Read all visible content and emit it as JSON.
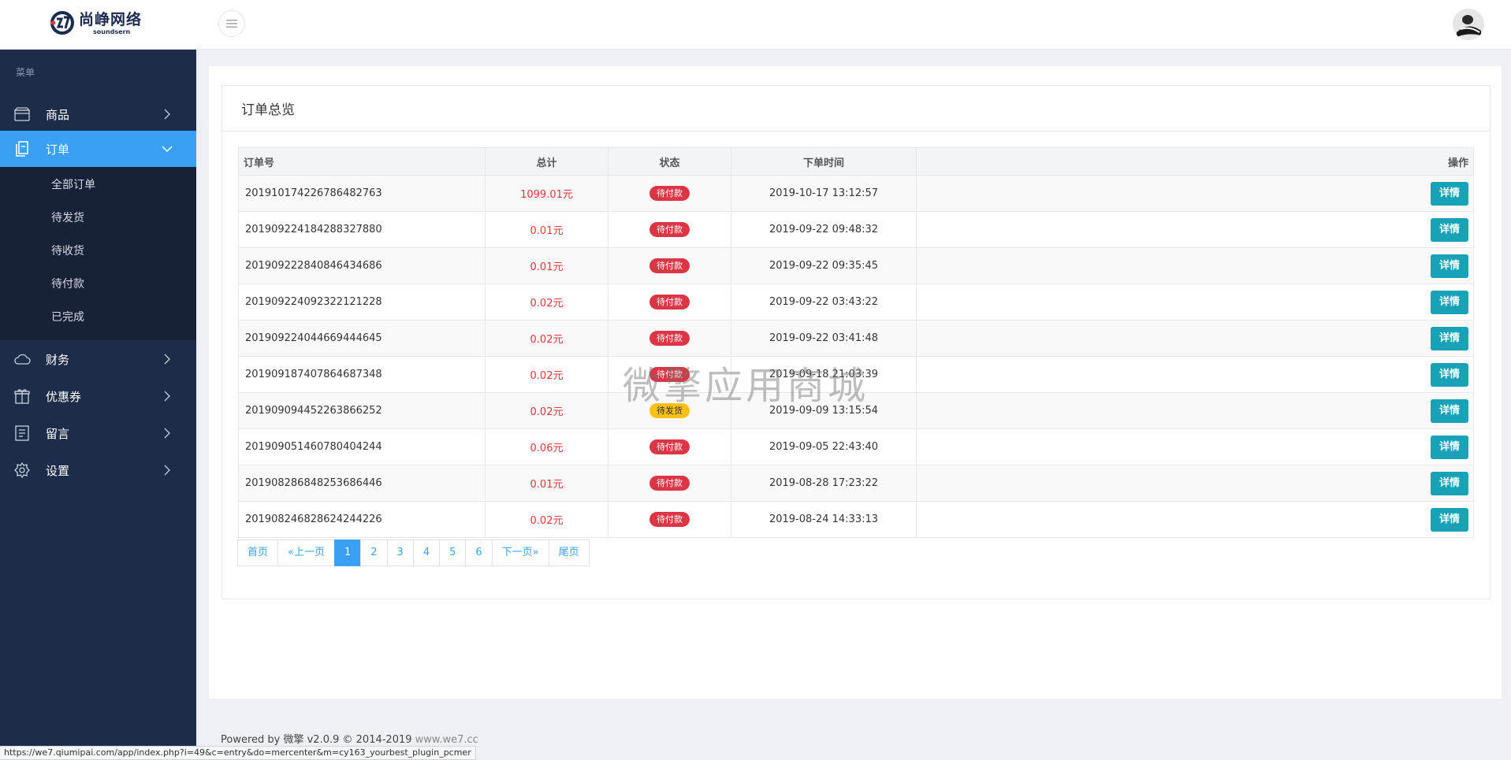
{
  "brand": {
    "name_cn": "尚峥网络",
    "name_en": "soundsern"
  },
  "sidebar": {
    "caption": "菜单",
    "items": [
      {
        "label": "商品",
        "icon": "box-icon"
      },
      {
        "label": "订单",
        "icon": "document-icon",
        "active": true
      },
      {
        "label": "财务",
        "icon": "cloud-icon"
      },
      {
        "label": "优惠券",
        "icon": "gift-icon"
      },
      {
        "label": "留言",
        "icon": "message-list-icon"
      },
      {
        "label": "设置",
        "icon": "gear-icon"
      }
    ],
    "order_submenu": [
      "全部订单",
      "待发货",
      "待收货",
      "待付款",
      "已完成"
    ]
  },
  "panel": {
    "title": "订单总览",
    "columns": [
      "订单号",
      "总计",
      "状态",
      "下单时间",
      "操作"
    ],
    "detail_label": "详情",
    "rows": [
      {
        "order_no": "201910174226786482763",
        "total": "1099.01元",
        "status": "待付款",
        "status_color": "#dc3545",
        "time": "2019-10-17 13:12:57"
      },
      {
        "order_no": "201909224184288327880",
        "total": "0.01元",
        "status": "待付款",
        "status_color": "#dc3545",
        "time": "2019-09-22 09:48:32"
      },
      {
        "order_no": "201909222840846434686",
        "total": "0.01元",
        "status": "待付款",
        "status_color": "#dc3545",
        "time": "2019-09-22 09:35:45"
      },
      {
        "order_no": "201909224092322121228",
        "total": "0.02元",
        "status": "待付款",
        "status_color": "#dc3545",
        "time": "2019-09-22 03:43:22"
      },
      {
        "order_no": "201909224044669444645",
        "total": "0.02元",
        "status": "待付款",
        "status_color": "#dc3545",
        "time": "2019-09-22 03:41:48"
      },
      {
        "order_no": "201909187407864687348",
        "total": "0.02元",
        "status": "待付款",
        "status_color": "#dc3545",
        "time": "2019-09-18 21:03:39"
      },
      {
        "order_no": "201909094452263866252",
        "total": "0.02元",
        "status": "待发货",
        "status_color": "#fcc014",
        "time": "2019-09-09 13:15:54"
      },
      {
        "order_no": "201909051460780404244",
        "total": "0.06元",
        "status": "待付款",
        "status_color": "#dc3545",
        "time": "2019-09-05 22:43:40"
      },
      {
        "order_no": "201908286848253686446",
        "total": "0.01元",
        "status": "待付款",
        "status_color": "#dc3545",
        "time": "2019-08-28 17:23:22"
      },
      {
        "order_no": "201908246828624244226",
        "total": "0.02元",
        "status": "待付款",
        "status_color": "#dc3545",
        "time": "2019-08-24 14:33:13"
      }
    ]
  },
  "pagination": {
    "first": "首页",
    "prev": "«上一页",
    "pages": [
      "1",
      "2",
      "3",
      "4",
      "5",
      "6"
    ],
    "current": "1",
    "next": "下一页»",
    "last": "尾页"
  },
  "watermark": "微擎应用商城",
  "footer": {
    "text": "Powered by 微擎 v2.0.9 © 2014-2019 ",
    "link": "www.we7.cc"
  },
  "status_url": "https://we7.qiumipai.com/app/index.php?i=49&c=entry&do=mercenter&m=cy163_yourbest_plugin_pcmer",
  "colors": {
    "sidebar_bg": "#1d2c48",
    "accent": "#3aa0f3",
    "detail_button": "#17a2b8",
    "price_red": "#e8363a"
  }
}
